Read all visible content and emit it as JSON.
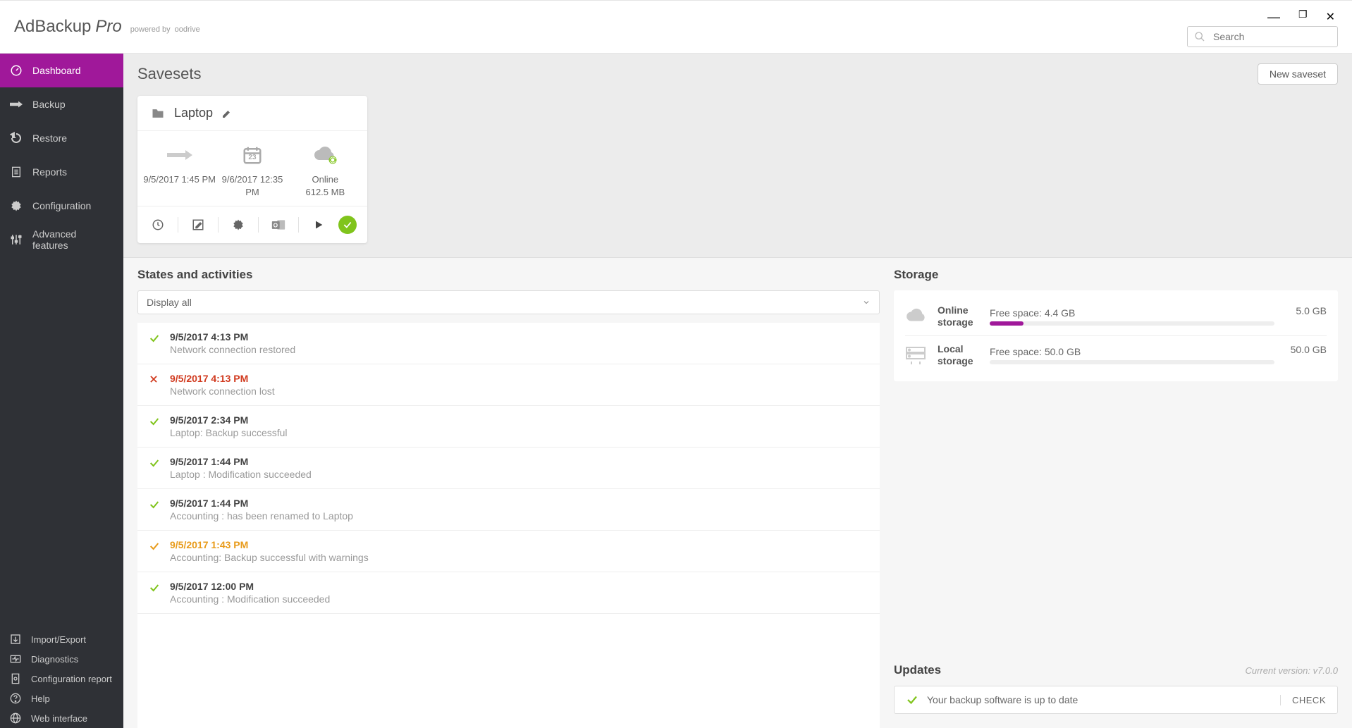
{
  "window": {
    "title_main": "AdBackup ",
    "title_pro": "Pro",
    "powered_prefix": "powered by ",
    "powered_brand": "oodrive"
  },
  "search": {
    "placeholder": "Search"
  },
  "nav": [
    {
      "id": "dashboard",
      "label": "Dashboard",
      "active": true
    },
    {
      "id": "backup",
      "label": "Backup"
    },
    {
      "id": "restore",
      "label": "Restore"
    },
    {
      "id": "reports",
      "label": "Reports"
    },
    {
      "id": "configuration",
      "label": "Configuration"
    },
    {
      "id": "advanced",
      "label": "Advanced features"
    }
  ],
  "nav_bottom": [
    {
      "id": "import-export",
      "label": "Import/Export"
    },
    {
      "id": "diagnostics",
      "label": "Diagnostics"
    },
    {
      "id": "config-report",
      "label": "Configuration report"
    },
    {
      "id": "help",
      "label": "Help"
    },
    {
      "id": "web-interface",
      "label": "Web interface"
    }
  ],
  "savesets": {
    "title": "Savesets",
    "new_button": "New saveset",
    "card": {
      "name": "Laptop",
      "last_run_date": "9/5/2017 1:45 PM",
      "next_run_date": "9/6/2017 12:35 PM",
      "cal_day": "23",
      "status_label": "Online",
      "status_size": "612.5 MB"
    }
  },
  "activities": {
    "title": "States and activities",
    "filter": "Display all",
    "items": [
      {
        "status": "ok",
        "time": "9/5/2017 4:13 PM",
        "desc": "Network connection restored"
      },
      {
        "status": "err",
        "time": "9/5/2017 4:13 PM",
        "desc": "Network connection lost"
      },
      {
        "status": "ok",
        "time": "9/5/2017 2:34 PM",
        "desc": "Laptop: Backup successful"
      },
      {
        "status": "ok",
        "time": "9/5/2017 1:44 PM",
        "desc": "Laptop : Modification succeeded"
      },
      {
        "status": "ok",
        "time": "9/5/2017 1:44 PM",
        "desc": "Accounting : has been renamed to Laptop"
      },
      {
        "status": "warn",
        "time": "9/5/2017 1:43 PM",
        "desc": "Accounting: Backup successful with warnings"
      },
      {
        "status": "ok",
        "time": "9/5/2017 12:00 PM",
        "desc": "Accounting : Modification succeeded"
      }
    ]
  },
  "storage": {
    "title": "Storage",
    "rows": [
      {
        "kind": "online",
        "label": "Online storage",
        "free_label": "Free space:",
        "free_value": "4.4 GB",
        "total": "5.0 GB",
        "used_pct": 12,
        "color": "#a0189a"
      },
      {
        "kind": "local",
        "label": "Local storage",
        "free_label": "Free space:",
        "free_value": "50.0 GB",
        "total": "50.0 GB",
        "used_pct": 0,
        "color": "#a0189a"
      }
    ]
  },
  "updates": {
    "title": "Updates",
    "version_label": "Current version:  v7.0.0",
    "message": "Your backup software is up to date",
    "check_button": "CHECK"
  }
}
